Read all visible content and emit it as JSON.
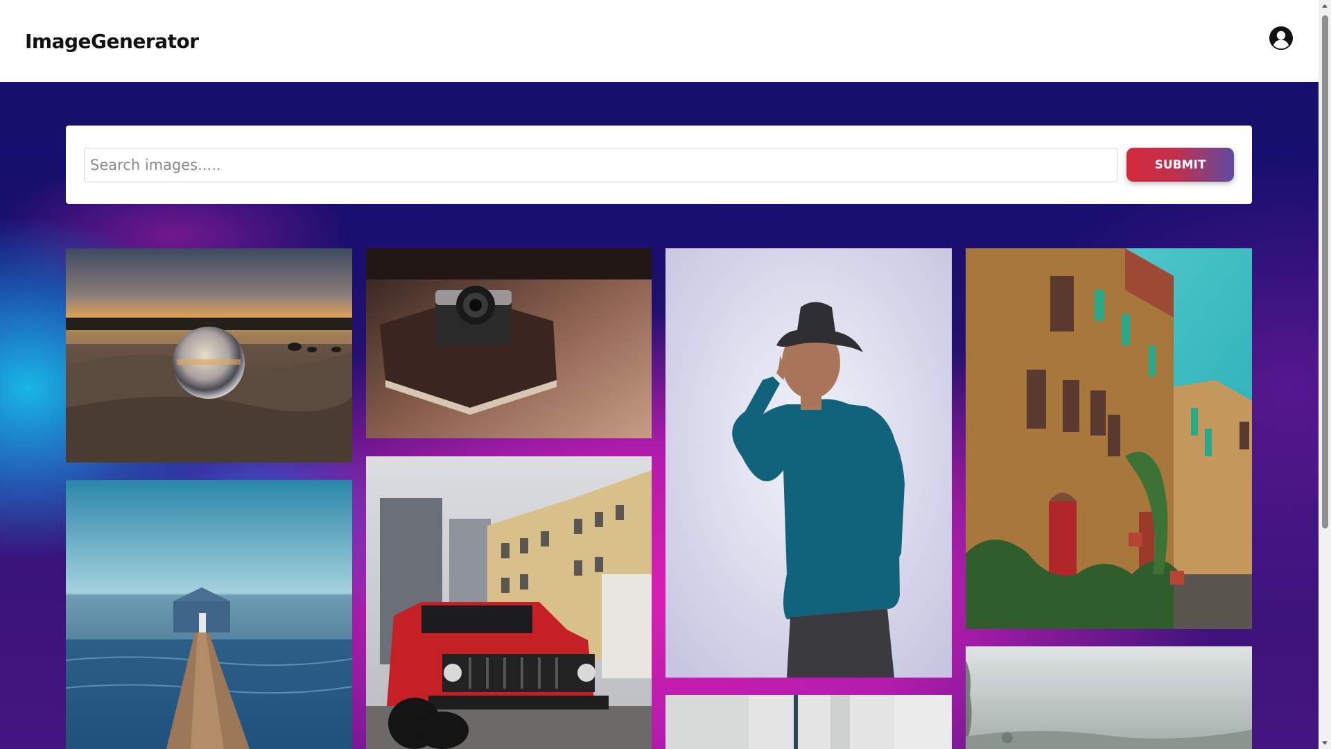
{
  "app": {
    "title": "ImageGenerator"
  },
  "header": {
    "account_icon": "user-circle-icon"
  },
  "search": {
    "placeholder": "Search images.....",
    "value": "",
    "submit_label": "SUBMIT"
  },
  "gallery": {
    "images": [
      {
        "subject": "crystal-ball-on-beach-sunset"
      },
      {
        "subject": "camera-on-notebook"
      },
      {
        "subject": "boy-in-hat-blue-shirt"
      },
      {
        "subject": "italian-stone-street-buildings"
      },
      {
        "subject": "boathouse-pier-on-water"
      },
      {
        "subject": "red-jeep-city-buildings"
      },
      {
        "subject": "white-interior-partial"
      },
      {
        "subject": "foggy-landscape-partial"
      }
    ]
  },
  "colors": {
    "submit_gradient_start": "#d42a3c",
    "submit_gradient_end": "#5f4ba0",
    "page_background": "#1a0f6e"
  }
}
